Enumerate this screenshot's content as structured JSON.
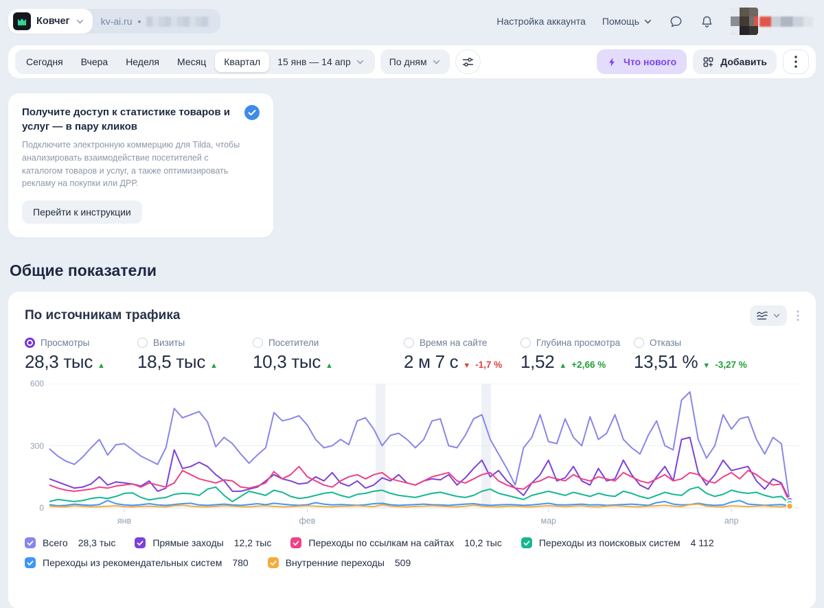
{
  "header": {
    "app_name": "Ковчег",
    "counter_domain": "kv-ai.ru",
    "counter_separator": "•",
    "account_settings": "Настройка аккаунта",
    "help": "Помощь"
  },
  "toolbar": {
    "periods": [
      "Сегодня",
      "Вчера",
      "Неделя",
      "Месяц",
      "Квартал"
    ],
    "selected_period": "Квартал",
    "date_range": "15 янв — 14 апр",
    "granularity": "По дням",
    "whats_new": "Что нового",
    "add": "Добавить"
  },
  "promo": {
    "title": "Получите доступ к статистике товаров и услуг — в пару кликов",
    "body": "Подключите электронную коммерцию для Tilda, чтобы анализировать взаимодействие посетителей с каталогом товаров и услуг, а также оптимизировать рекламу на покупки или ДРР.",
    "button": "Перейти к инструкции"
  },
  "section_title": "Общие показатели",
  "widget": {
    "title": "По источникам трафика",
    "metrics": [
      {
        "label": "Просмотры",
        "value": "28,3 тыс",
        "arrow": "▲",
        "delta": "",
        "delta_color": "#21a038",
        "selected": true,
        "radio_color": "#7733d9"
      },
      {
        "label": "Визиты",
        "value": "18,5 тыс",
        "arrow": "▲",
        "delta": "",
        "delta_color": "#21a038"
      },
      {
        "label": "Посетители",
        "value": "10,3 тыс",
        "arrow": "▲",
        "delta": "",
        "delta_color": "#21a038"
      },
      {
        "label": "Время на сайте",
        "value": "2 м 7 с",
        "arrow": "▼",
        "delta": "-1,7 %",
        "delta_color": "#e23d3d"
      },
      {
        "label": "Глубина просмотра",
        "value": "1,52",
        "arrow": "▲",
        "delta": "+2,66 %",
        "delta_color": "#21a038"
      },
      {
        "label": "Отказы",
        "value": "13,51 %",
        "arrow": "▼",
        "delta": "-3,27 %",
        "delta_color": "#21a038"
      }
    ],
    "legend": [
      {
        "label": "Всего",
        "value": "28,3 тыс",
        "color": "#8886e9"
      },
      {
        "label": "Прямые заходы",
        "value": "12,2 тыс",
        "color": "#7b41d9"
      },
      {
        "label": "Переходы по ссылкам на сайтах",
        "value": "10,2 тыс",
        "color": "#ef4187"
      },
      {
        "label": "Переходы из поисковых систем",
        "value": "4 112",
        "color": "#14b890"
      },
      {
        "label": "Переходы из рекомендательных систем",
        "value": "780",
        "color": "#3f97f5"
      },
      {
        "label": "Внутренние переходы",
        "value": "509",
        "color": "#f6ab38"
      }
    ]
  },
  "chart_data": {
    "type": "line",
    "title": "По источникам трафика",
    "x_unit": "день, 15 янв — 14 апр",
    "ylim": [
      0,
      600
    ],
    "yticks": [
      0,
      300,
      600
    ],
    "grid": true,
    "legend_position": "bottom",
    "month_labels": [
      {
        "label": "янв",
        "day": 9
      },
      {
        "label": "фев",
        "day": 31
      },
      {
        "label": "мар",
        "day": 60
      },
      {
        "label": "апр",
        "day": 82
      }
    ],
    "holiday_bands": [
      {
        "day": 39.8
      },
      {
        "day": 52.5
      }
    ],
    "series": [
      {
        "name": "Всего",
        "color": "#8886e9",
        "total": "28,3 тыс",
        "values": [
          285,
          250,
          225,
          210,
          245,
          290,
          330,
          255,
          305,
          310,
          280,
          250,
          230,
          210,
          290,
          480,
          435,
          450,
          465,
          415,
          295,
          340,
          310,
          260,
          215,
          255,
          290,
          460,
          420,
          430,
          445,
          400,
          330,
          290,
          300,
          330,
          305,
          420,
          435,
          380,
          300,
          350,
          360,
          330,
          290,
          330,
          420,
          430,
          300,
          290,
          350,
          430,
          450,
          330,
          260,
          190,
          110,
          290,
          340,
          450,
          320,
          310,
          430,
          340,
          300,
          440,
          330,
          360,
          450,
          330,
          290,
          260,
          350,
          420,
          300,
          280,
          520,
          560,
          330,
          240,
          300,
          450,
          380,
          430,
          440,
          330,
          260,
          340,
          310,
          30
        ]
      },
      {
        "name": "Прямые заходы",
        "color": "#7b41d9",
        "total": "12,2 тыс",
        "values": [
          140,
          125,
          110,
          95,
          100,
          115,
          150,
          110,
          125,
          120,
          115,
          105,
          130,
          80,
          95,
          280,
          190,
          200,
          220,
          200,
          160,
          130,
          80,
          80,
          90,
          100,
          130,
          160,
          140,
          130,
          115,
          120,
          150,
          130,
          170,
          120,
          105,
          130,
          95,
          110,
          145,
          130,
          160,
          120,
          110,
          130,
          140,
          135,
          160,
          110,
          145,
          190,
          230,
          150,
          180,
          130,
          95,
          60,
          120,
          160,
          230,
          130,
          145,
          200,
          130,
          110,
          190,
          130,
          140,
          230,
          160,
          110,
          90,
          150,
          200,
          130,
          330,
          340,
          170,
          110,
          160,
          230,
          180,
          190,
          200,
          130,
          90,
          140,
          120,
          35
        ]
      },
      {
        "name": "Переходы по ссылкам на сайтах",
        "color": "#ef4187",
        "total": "10,2 тыс",
        "values": [
          110,
          95,
          85,
          80,
          85,
          90,
          100,
          95,
          105,
          110,
          115,
          100,
          120,
          110,
          100,
          120,
          180,
          160,
          140,
          130,
          120,
          135,
          130,
          100,
          95,
          105,
          120,
          175,
          140,
          160,
          200,
          150,
          130,
          110,
          100,
          130,
          150,
          160,
          140,
          160,
          170,
          140,
          130,
          120,
          110,
          130,
          150,
          160,
          170,
          130,
          120,
          140,
          160,
          170,
          130,
          110,
          95,
          90,
          120,
          130,
          150,
          140,
          130,
          160,
          140,
          130,
          150,
          140,
          130,
          170,
          150,
          130,
          120,
          140,
          160,
          130,
          140,
          170,
          160,
          130,
          120,
          150,
          170,
          140,
          180,
          160,
          130,
          110,
          115,
          25
        ]
      },
      {
        "name": "Переходы из поисковых систем",
        "color": "#14b890",
        "total": "4 112",
        "values": [
          30,
          40,
          35,
          30,
          35,
          45,
          50,
          45,
          55,
          70,
          72,
          50,
          38,
          45,
          50,
          65,
          70,
          68,
          60,
          90,
          100,
          60,
          30,
          55,
          80,
          70,
          60,
          85,
          75,
          55,
          45,
          50,
          60,
          70,
          75,
          60,
          50,
          65,
          70,
          80,
          85,
          70,
          60,
          55,
          50,
          60,
          70,
          75,
          65,
          55,
          50,
          60,
          80,
          90,
          70,
          60,
          50,
          40,
          60,
          70,
          80,
          70,
          60,
          75,
          65,
          55,
          70,
          60,
          55,
          80,
          70,
          55,
          45,
          60,
          75,
          65,
          60,
          90,
          100,
          70,
          55,
          65,
          85,
          75,
          70,
          75,
          60,
          50,
          55,
          20
        ]
      },
      {
        "name": "Переходы из рекомендательных систем",
        "color": "#3f97f5",
        "total": "780",
        "values": [
          15,
          10,
          12,
          18,
          14,
          12,
          16,
          35,
          20,
          14,
          12,
          15,
          20,
          14,
          12,
          16,
          20,
          22,
          14,
          12,
          15,
          18,
          14,
          12,
          16,
          20,
          15,
          22,
          18,
          14,
          12,
          15,
          25,
          18,
          14,
          16,
          14,
          12,
          15,
          20,
          22,
          15,
          12,
          14,
          16,
          18,
          15,
          14,
          12,
          15,
          18,
          20,
          15,
          12,
          14,
          16,
          15,
          12,
          14,
          18,
          22,
          15,
          14,
          16,
          18,
          14,
          15,
          12,
          14,
          16,
          18,
          15,
          12,
          25,
          30,
          18,
          14,
          16,
          22,
          15,
          12,
          14,
          28,
          35,
          18,
          15,
          12,
          14,
          16,
          10
        ]
      },
      {
        "name": "Внутренние переходы",
        "color": "#f6ab38",
        "total": "509",
        "values": [
          8,
          6,
          5,
          10,
          7,
          5,
          6,
          8,
          10,
          6,
          5,
          7,
          8,
          6,
          5,
          10,
          12,
          8,
          6,
          5,
          7,
          10,
          8,
          6,
          5,
          8,
          10,
          7,
          5,
          6,
          8,
          10,
          8,
          6,
          5,
          7,
          8,
          10,
          8,
          6,
          15,
          8,
          6,
          5,
          7,
          8,
          10,
          8,
          6,
          5,
          8,
          12,
          8,
          6,
          5,
          7,
          8,
          6,
          5,
          8,
          10,
          8,
          6,
          8,
          10,
          6,
          5,
          8,
          10,
          8,
          6,
          5,
          8,
          10,
          12,
          8,
          6,
          15,
          18,
          8,
          6,
          5,
          10,
          8,
          6,
          8,
          10,
          6,
          5,
          8
        ]
      }
    ]
  },
  "icons": {
    "app_logo": "ark-logo",
    "whats_new": "lightning-bolt",
    "add": "widgets-grid",
    "filter": "sliders",
    "chart_type": "line-waves",
    "promo_badge": "check-circle"
  }
}
